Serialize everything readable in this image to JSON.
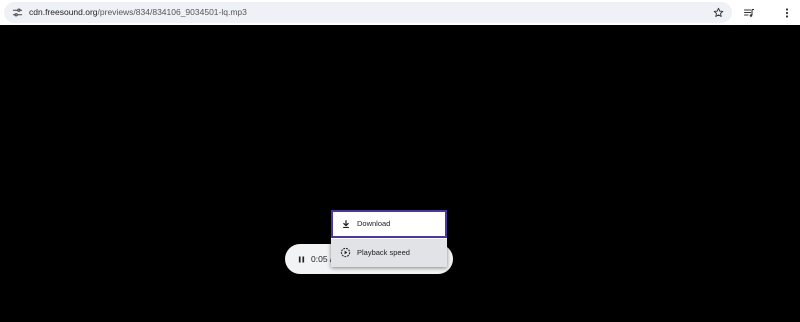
{
  "browser": {
    "url_host": "cdn.freesound.org",
    "url_path": "/previews/834/834106_9034501-lq.mp3",
    "icons": {
      "site_info": "tune-icon",
      "bookmark": "star-icon",
      "media_controls": "queue-music-icon",
      "menu": "more-vert-icon"
    }
  },
  "player": {
    "state_icon": "pause-icon",
    "time_text": "0:05 /"
  },
  "context_menu": {
    "items": [
      {
        "label": "Download",
        "icon": "download-icon",
        "focused": true
      },
      {
        "label": "Playback speed",
        "icon": "playback-speed-icon",
        "focused": false
      }
    ]
  },
  "colors": {
    "page_background": "#000000",
    "focus_ring": "#4a3aa0",
    "player_background": "#f1f3f4"
  }
}
